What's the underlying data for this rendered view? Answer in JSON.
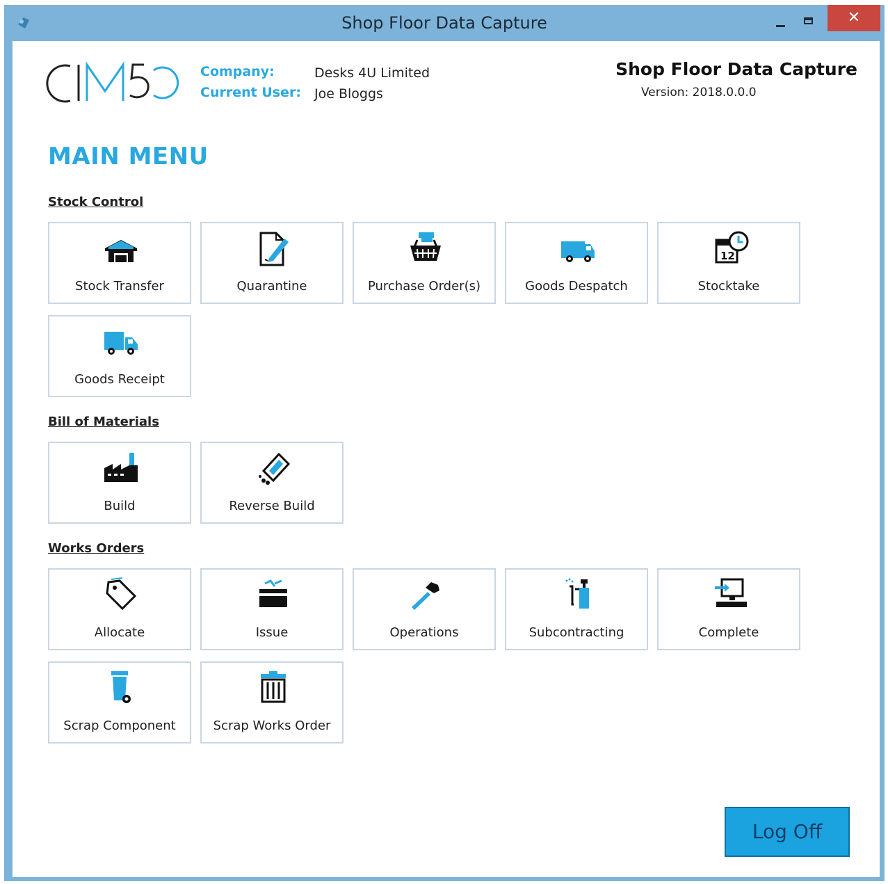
{
  "window": {
    "title": "Shop Floor Data Capture",
    "close_glyph": "✕"
  },
  "header": {
    "company_label": "Company:",
    "company_value": "Desks 4U Limited",
    "user_label": "Current User:",
    "user_value": "Joe Bloggs",
    "app_name": "Shop Floor Data Capture",
    "version": "Version: 2018.0.0.0"
  },
  "logo": {
    "text": "CIM50"
  },
  "main_menu_title": "MAIN MENU",
  "sections": {
    "stock_control": {
      "title": "Stock Control",
      "tiles": [
        {
          "label": "Stock Transfer",
          "icon": "warehouse-icon"
        },
        {
          "label": "Quarantine",
          "icon": "document-edit-icon"
        },
        {
          "label": "Purchase Order(s)",
          "icon": "shopping-basket-icon"
        },
        {
          "label": "Goods Despatch",
          "icon": "van-icon"
        },
        {
          "label": "Stocktake",
          "icon": "calendar-clock-icon"
        },
        {
          "label": "Goods Receipt",
          "icon": "truck-icon"
        }
      ]
    },
    "bill_of_materials": {
      "title": "Bill of Materials",
      "tiles": [
        {
          "label": "Build",
          "icon": "factory-icon"
        },
        {
          "label": "Reverse Build",
          "icon": "reverse-build-icon"
        }
      ]
    },
    "works_orders": {
      "title": "Works Orders",
      "tiles": [
        {
          "label": "Allocate",
          "icon": "tag-icon"
        },
        {
          "label": "Issue",
          "icon": "tray-icon"
        },
        {
          "label": "Operations",
          "icon": "hammer-icon"
        },
        {
          "label": "Subcontracting",
          "icon": "spray-bottle-icon"
        },
        {
          "label": "Complete",
          "icon": "computer-icon"
        },
        {
          "label": "Scrap Component",
          "icon": "wheelie-bin-icon"
        },
        {
          "label": "Scrap Works Order",
          "icon": "trash-can-icon"
        }
      ]
    }
  },
  "logoff_label": "Log Off",
  "colors": {
    "accent": "#29a8e0",
    "titlebar": "#7db3d9",
    "close": "#c9473f",
    "logoff": "#1ba3e0"
  }
}
